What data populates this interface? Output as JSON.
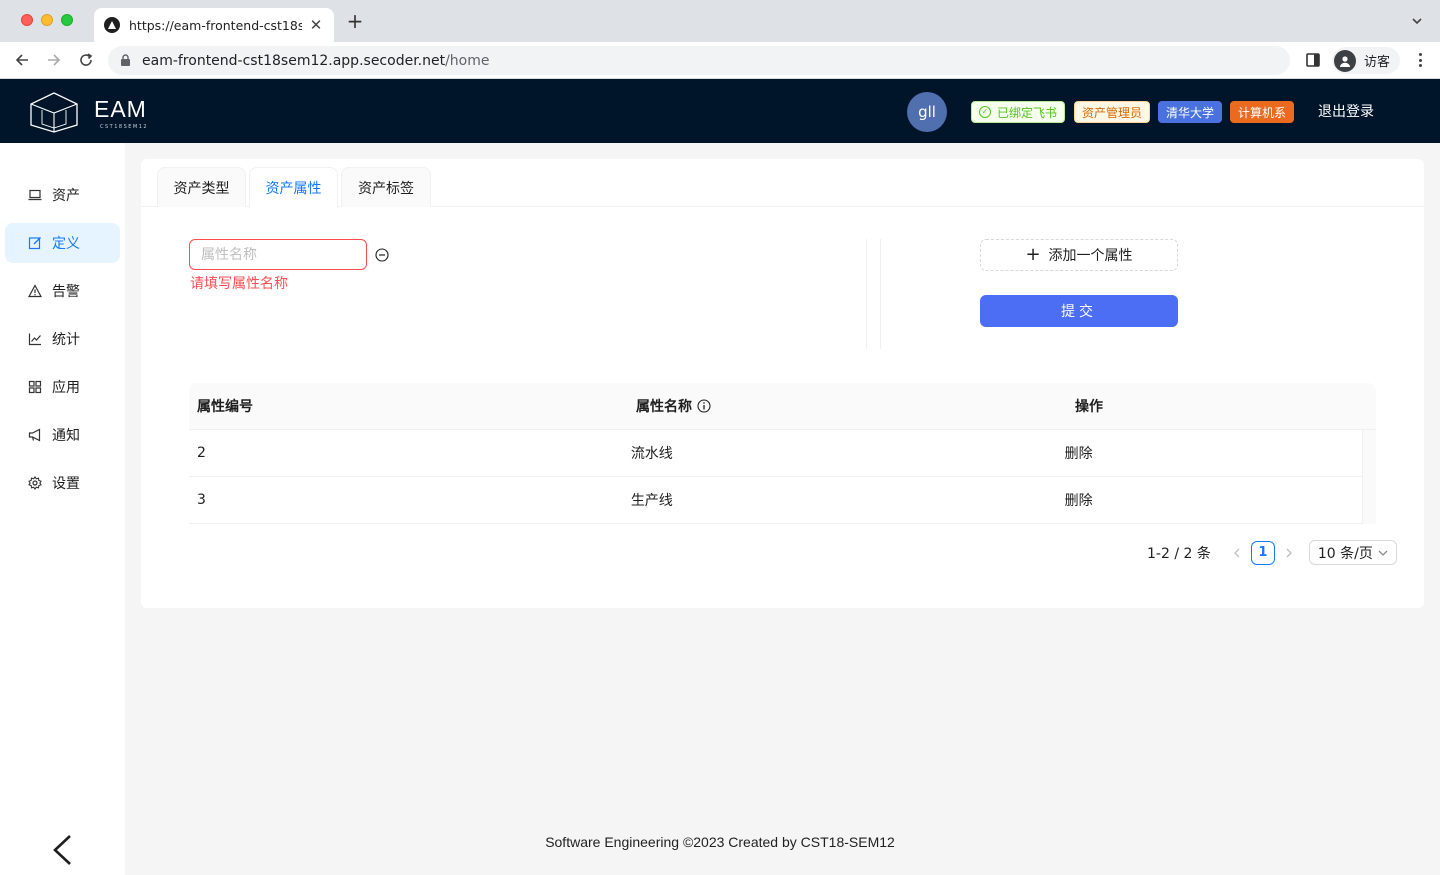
{
  "browser": {
    "tab_title": "https://eam-frontend-cst18sem12.app.secoder.net/home",
    "url_host": "eam-frontend-cst18sem12.app.secoder.net",
    "url_path": "/home",
    "profile_label": "访客"
  },
  "header": {
    "logo_text": "EAM",
    "logo_sub": "CST18SEM12",
    "user_initials": "gll",
    "tags": {
      "feishu": "已绑定飞书",
      "role": "资产管理员",
      "university": "清华大学",
      "department": "计算机系"
    },
    "logout_label": "退出登录",
    "colors": {
      "bar": "#001529",
      "university_tag": "#4a71e0",
      "department_tag": "#ea6b1f"
    }
  },
  "sidebar": {
    "items": [
      {
        "label": "资产",
        "icon": "laptop-icon"
      },
      {
        "label": "定义",
        "icon": "edit-icon"
      },
      {
        "label": "告警",
        "icon": "warning-icon"
      },
      {
        "label": "统计",
        "icon": "line-chart-icon"
      },
      {
        "label": "应用",
        "icon": "appstore-icon"
      },
      {
        "label": "通知",
        "icon": "notification-icon"
      },
      {
        "label": "设置",
        "icon": "setting-icon"
      }
    ],
    "active": "定义",
    "collapse_icon": "chevron-left-icon"
  },
  "tabs": [
    {
      "label": "资产类型"
    },
    {
      "label": "资产属性"
    },
    {
      "label": "资产标签"
    }
  ],
  "active_tab": "资产属性",
  "form": {
    "input_placeholder": "属性名称",
    "input_value": "",
    "error_message": "请填写属性名称",
    "add_button_label": "添加一个属性",
    "submit_label": "提交",
    "accent_color": "#4c6ef5"
  },
  "table": {
    "columns": [
      "属性编号",
      "属性名称",
      "操作"
    ],
    "rows": [
      {
        "id": "2",
        "name": "流水线",
        "action": "删除"
      },
      {
        "id": "3",
        "name": "生产线",
        "action": "删除"
      }
    ]
  },
  "pagination": {
    "total_label": "1-2 / 2 条",
    "current_page": "1",
    "page_size_label": "10 条/页"
  },
  "footer": "Software Engineering ©2023 Created by CST18-SEM12"
}
